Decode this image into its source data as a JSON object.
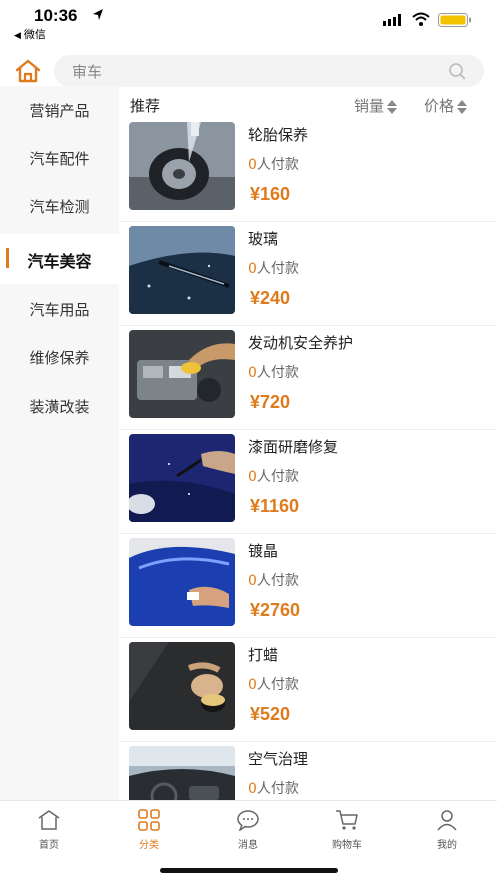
{
  "status": {
    "time": "10:36",
    "back_app": "微信"
  },
  "search": {
    "placeholder": "审车"
  },
  "sidebar": {
    "items": [
      {
        "label": "营销产品"
      },
      {
        "label": "汽车配件"
      },
      {
        "label": "汽车检测"
      },
      {
        "label": "汽车美容"
      },
      {
        "label": "汽车用品"
      },
      {
        "label": "维修保养"
      },
      {
        "label": "装潢改装"
      }
    ],
    "active_index": 3
  },
  "sort": {
    "recommend": "推荐",
    "sales": "销量",
    "price": "价格"
  },
  "products": [
    {
      "name": "轮胎保养",
      "paid_count": "0",
      "paid_suffix": "人付款",
      "price": "¥160",
      "image": "tire-wash-photo"
    },
    {
      "name": "玻璃",
      "paid_count": "0",
      "paid_suffix": "人付款",
      "price": "¥240",
      "image": "windshield-wiper-photo"
    },
    {
      "name": "发动机安全养护",
      "paid_count": "0",
      "paid_suffix": "人付款",
      "price": "¥720",
      "image": "engine-cleaning-photo"
    },
    {
      "name": "漆面研磨修复",
      "paid_count": "0",
      "paid_suffix": "人付款",
      "price": "¥1160",
      "image": "paint-repair-photo"
    },
    {
      "name": "镀晶",
      "paid_count": "0",
      "paid_suffix": "人付款",
      "price": "¥2760",
      "image": "ceramic-coating-photo"
    },
    {
      "name": "打蜡",
      "paid_count": "0",
      "paid_suffix": "人付款",
      "price": "¥520",
      "image": "waxing-photo"
    },
    {
      "name": "空气治理",
      "paid_count": "0",
      "paid_suffix": "人付款",
      "price": "",
      "image": "car-interior-photo"
    }
  ],
  "tabbar": {
    "items": [
      {
        "label": "首页",
        "icon": "home-tab-icon"
      },
      {
        "label": "分类",
        "icon": "category-tab-icon"
      },
      {
        "label": "消息",
        "icon": "message-tab-icon"
      },
      {
        "label": "购物车",
        "icon": "cart-tab-icon"
      },
      {
        "label": "我的",
        "icon": "profile-tab-icon"
      }
    ],
    "active_index": 1
  },
  "colors": {
    "accent": "#e07b1d",
    "sidebar_bg": "#f7f7f7"
  }
}
